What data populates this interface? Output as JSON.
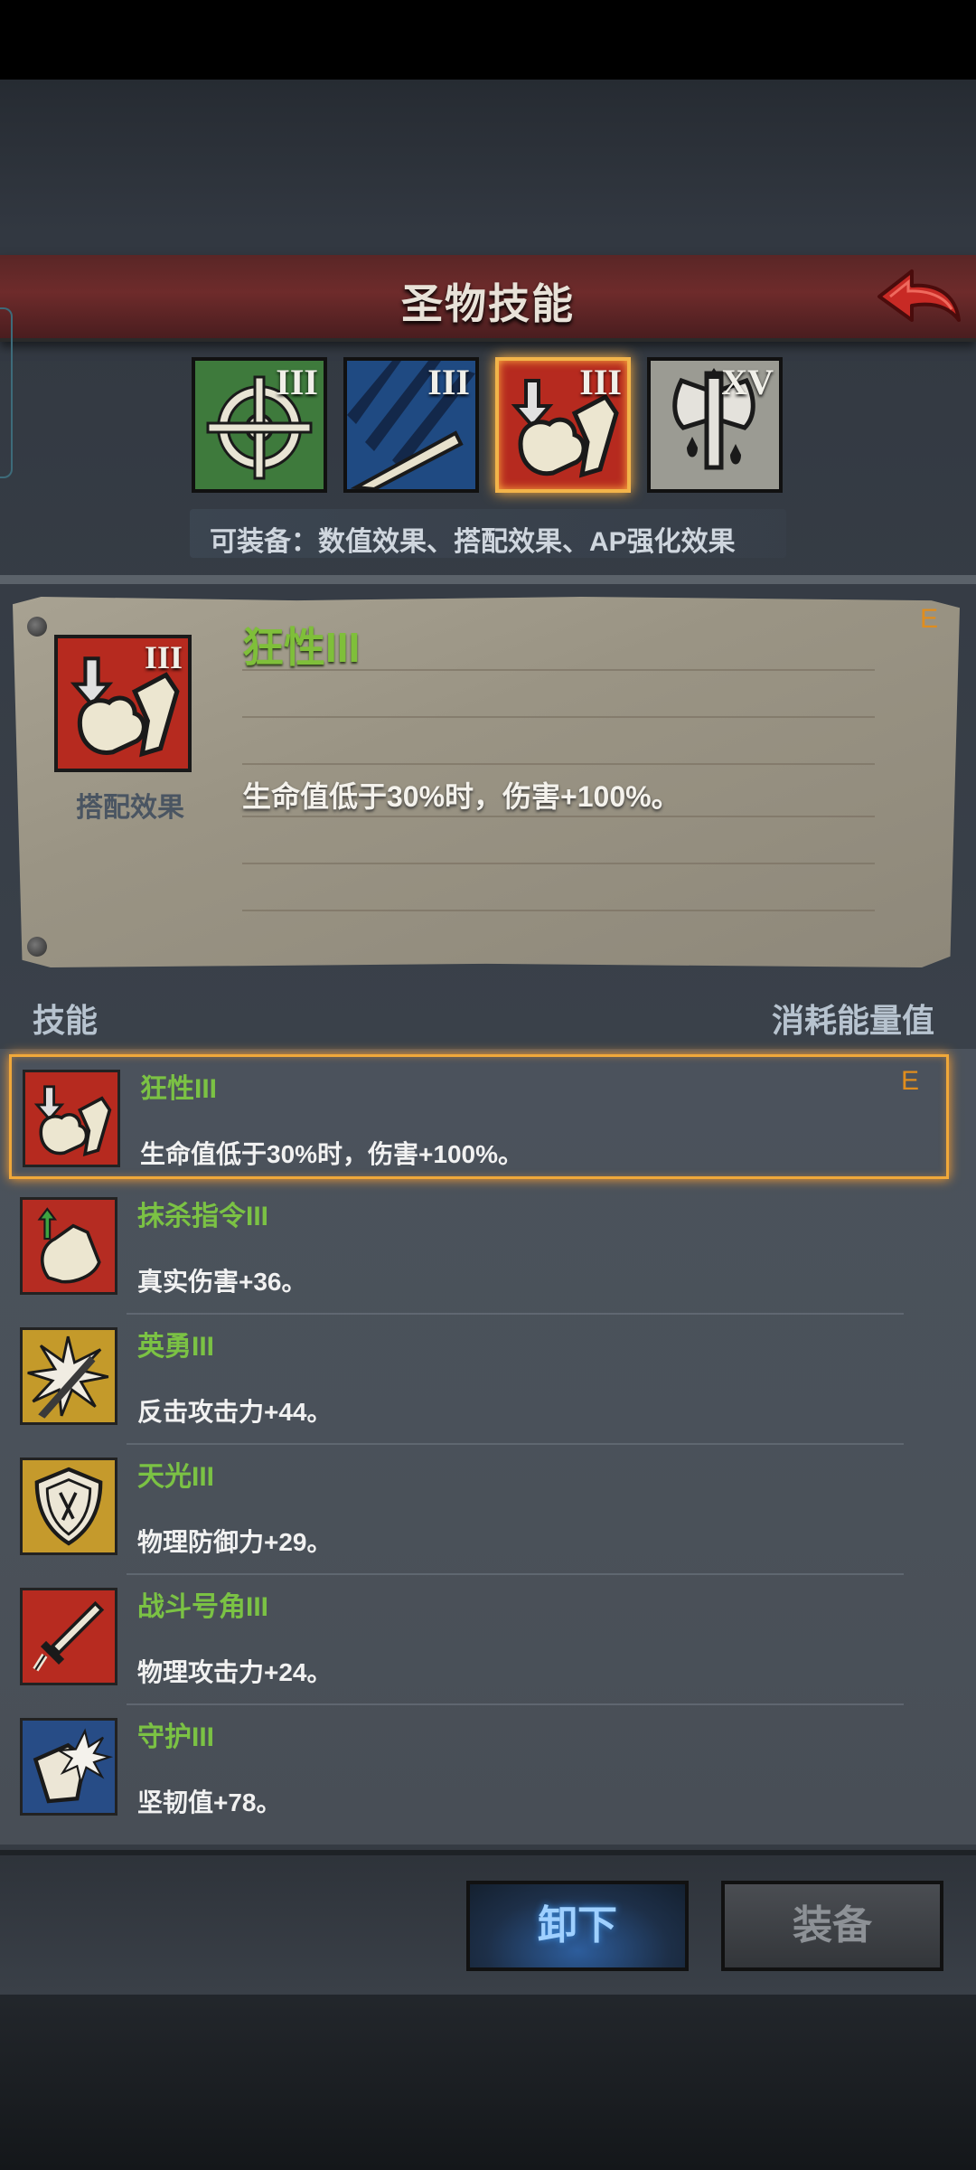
{
  "header": {
    "title": "圣物技能"
  },
  "slots": [
    {
      "icon": "crosshair-icon",
      "tier": "III",
      "color": "#3e7a3c"
    },
    {
      "icon": "claw-slash-icon",
      "tier": "III",
      "color": "#1f4a82"
    },
    {
      "icon": "berserk-icon",
      "tier": "III",
      "color": "#b62a1f",
      "selected": true
    },
    {
      "icon": "axe-blood-icon",
      "tier": "XV",
      "color": "#9b9b93"
    }
  ],
  "equip_note": "可装备：数值效果、搭配效果、AP强化效果",
  "detail": {
    "icon_tier": "III",
    "icon_label": "搭配效果",
    "title": "狂性III",
    "grade": "E",
    "description": "生命值低于30%时，伤害+100%。"
  },
  "list_header": {
    "left": "技能",
    "right": "消耗能量值"
  },
  "skills": [
    {
      "name": "狂性III",
      "desc": "生命值低于30%时，伤害+100%。",
      "grade": "E",
      "icon": "berserk-icon",
      "selected": true
    },
    {
      "name": "抹杀指令III",
      "desc": "真实伤害+36。",
      "grade": "",
      "icon": "fist-arrow-icon"
    },
    {
      "name": "英勇III",
      "desc": "反击攻击力+44。",
      "grade": "",
      "icon": "spear-burst-icon"
    },
    {
      "name": "天光III",
      "desc": "物理防御力+29。",
      "grade": "",
      "icon": "shield-icon"
    },
    {
      "name": "战斗号角III",
      "desc": "物理攻击力+24。",
      "grade": "",
      "icon": "sword-icon"
    },
    {
      "name": "守护III",
      "desc": "坚韧值+78。",
      "grade": "",
      "icon": "guard-burst-icon"
    }
  ],
  "buttons": {
    "unequip": "卸下",
    "equip": "装备"
  }
}
